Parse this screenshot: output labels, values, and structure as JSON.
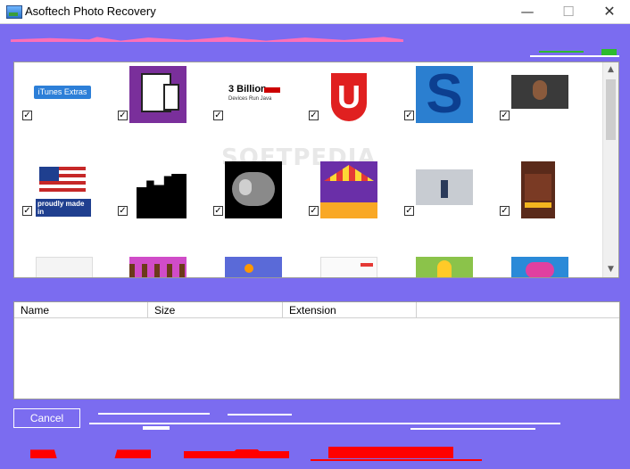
{
  "window": {
    "title": "Asoftech Photo Recovery",
    "minimize": "—",
    "maximize": "☐",
    "close": "✕"
  },
  "thumbnails": {
    "watermark": "SOFTPEDIA",
    "checked_mark": "✓",
    "items": [
      {
        "name": "itunes-extras-badge",
        "text": "iTunes Extras"
      },
      {
        "name": "tablet-phone-image"
      },
      {
        "name": "3-billion-devices-image",
        "text": "3 Billion",
        "subtext": "Devices Run Java"
      },
      {
        "name": "u-logo-image",
        "text": "U"
      },
      {
        "name": "s-logo-image",
        "text": "S"
      },
      {
        "name": "portrait-photo"
      },
      {
        "name": "american-flag-image",
        "text": "proudly made in"
      },
      {
        "name": "silhouette-image"
      },
      {
        "name": "ct-scan-image"
      },
      {
        "name": "carousel-illustration"
      },
      {
        "name": "snow-scene-photo"
      },
      {
        "name": "phone-app-screenshot"
      },
      {
        "name": "document-screenshot"
      },
      {
        "name": "game-trees-image"
      },
      {
        "name": "space-illustration"
      },
      {
        "name": "webpage-screenshot"
      },
      {
        "name": "cartoon-scene-image"
      },
      {
        "name": "candy-game-image"
      }
    ]
  },
  "file_list": {
    "columns": [
      "Name",
      "Size",
      "Extension"
    ]
  },
  "actions": {
    "cancel_label": "Cancel"
  }
}
